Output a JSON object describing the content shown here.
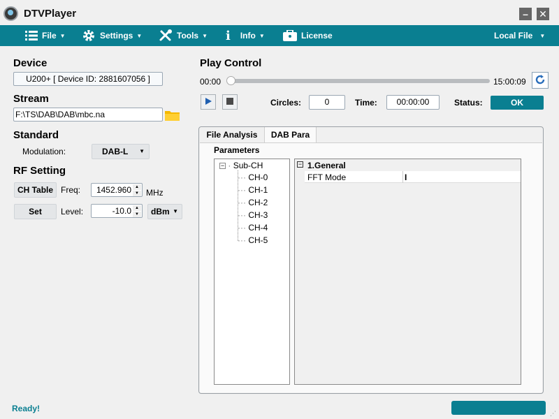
{
  "window": {
    "title": "DTVPlayer"
  },
  "menu": {
    "file": "File",
    "settings": "Settings",
    "tools": "Tools",
    "info": "Info",
    "license": "License",
    "local_file": "Local File"
  },
  "device": {
    "heading": "Device",
    "value": "U200+ [ Device ID: 2881607056 ]"
  },
  "stream": {
    "heading": "Stream",
    "path": "F:\\TS\\DAB\\DAB\\mbc.na"
  },
  "standard": {
    "heading": "Standard",
    "modulation_label": "Modulation:",
    "modulation_value": "DAB-L"
  },
  "rf": {
    "heading": "RF Setting",
    "ch_table_button": "CH Table",
    "freq_label": "Freq:",
    "freq_value": "1452.960",
    "freq_unit": "MHz",
    "set_button": "Set",
    "level_label": "Level:",
    "level_value": "-10.0",
    "level_unit": "dBm"
  },
  "play_control": {
    "heading": "Play Control",
    "time_start": "00:00",
    "time_end": "15:00:09",
    "progress": 0,
    "circles_label": "Circles:",
    "circles_value": "0",
    "time_label": "Time:",
    "time_value": "00:00:00",
    "status_label": "Status:",
    "status_value": "OK"
  },
  "tabs": {
    "file_analysis": "File Analysis",
    "dab_para": "DAB Para"
  },
  "parameters": {
    "heading": "Parameters",
    "tree_root": "Sub-CH",
    "tree_children": [
      "CH-0",
      "CH-1",
      "CH-2",
      "CH-3",
      "CH-4",
      "CH-5"
    ],
    "group_title": "1.General",
    "row_name": "FFT Mode",
    "row_value": "I"
  },
  "statusbar": {
    "text": "Ready!"
  },
  "colors": {
    "accent": "#0a7f91",
    "status_ok": "#0a7f91"
  }
}
